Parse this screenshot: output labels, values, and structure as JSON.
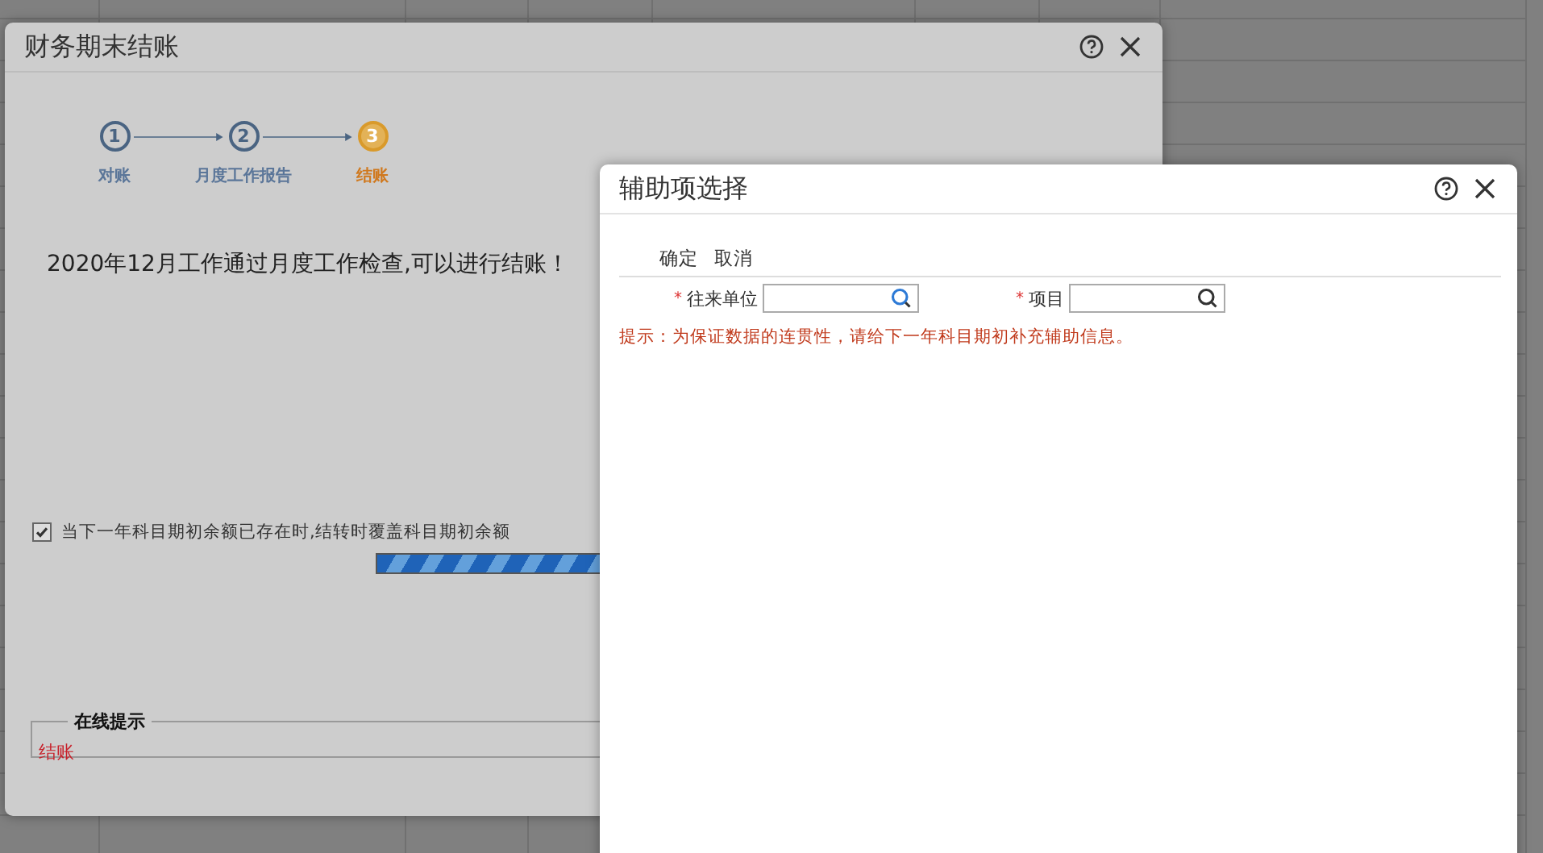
{
  "main_dialog": {
    "title": "财务期末结账",
    "steps": [
      {
        "number": "1",
        "label": "对账",
        "current": false
      },
      {
        "number": "2",
        "label": "月度工作报告",
        "current": false
      },
      {
        "number": "3",
        "label": "结账",
        "current": true
      }
    ],
    "message": "2020年12月工作通过月度工作检查,可以进行结账！",
    "option": {
      "label": "当下一年科目期初余额已存在时,结转时覆盖科目期初余额",
      "checked": true
    },
    "progress": {
      "level": 1
    },
    "online_tips": {
      "legend": "在线提示",
      "text": "结账"
    }
  },
  "aux_dialog": {
    "title": "辅助项选择",
    "actions": [
      "确定",
      "取消"
    ],
    "fields": [
      {
        "label": "往来单位",
        "required_mark": "*"
      },
      {
        "label": "项目",
        "required_mark": "*"
      }
    ],
    "hint": "提示：为保证数据的连贯性，请给下一年科目期初补充辅助信息。"
  }
}
